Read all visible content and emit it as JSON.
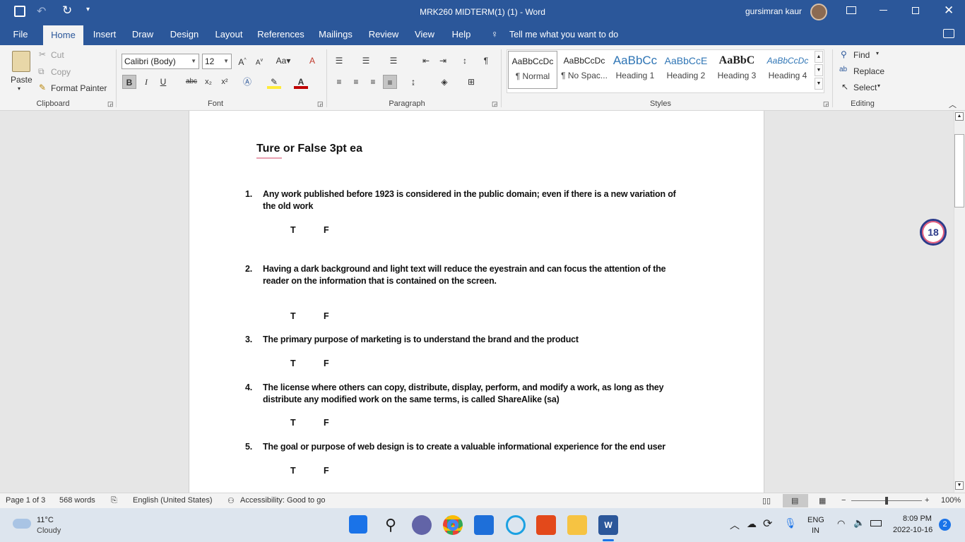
{
  "window": {
    "title": "MRK260 MIDTERM(1) (1)  -  Word",
    "user": "gursimran kaur"
  },
  "menu": {
    "file": "File",
    "tabs": [
      "Home",
      "Insert",
      "Draw",
      "Design",
      "Layout",
      "References",
      "Mailings",
      "Review",
      "View",
      "Help"
    ],
    "tell_me": "Tell me what you want to do"
  },
  "ribbon": {
    "clipboard": {
      "paste": "Paste",
      "cut": "Cut",
      "copy": "Copy",
      "format_painter": "Format Painter",
      "label": "Clipboard"
    },
    "font": {
      "name": "Calibri (Body)",
      "size": "12",
      "label": "Font"
    },
    "paragraph": {
      "label": "Paragraph"
    },
    "styles": {
      "label": "Styles",
      "items": [
        {
          "preview": "AaBbCcDc",
          "name": "¶ Normal"
        },
        {
          "preview": "AaBbCcDc",
          "name": "¶ No Spac..."
        },
        {
          "preview": "AaBbCc",
          "name": "Heading 1"
        },
        {
          "preview": "AaBbCcE",
          "name": "Heading 2"
        },
        {
          "preview": "AaBbC",
          "name": "Heading 3"
        },
        {
          "preview": "AaBbCcDc",
          "name": "Heading 4"
        }
      ]
    },
    "editing": {
      "find": "Find",
      "replace": "Replace",
      "select": "Select",
      "label": "Editing"
    }
  },
  "document": {
    "title": "Ture or False 3pt ea",
    "true_label": "T",
    "false_label": "F",
    "questions": [
      {
        "num": "1.",
        "text": "Any work published before 1923 is considered in the public domain; even if there is a new variation of the old work"
      },
      {
        "num": "2.",
        "text": "Having a dark background and light text will reduce the eyestrain and can focus the attention of the reader on the information that is contained on the screen."
      },
      {
        "num": "3.",
        "text": "The primary purpose of marketing is to understand the brand and the product"
      },
      {
        "num": "4.",
        "text": "The license where others can copy, distribute, display, perform, and modify a work, as long as they distribute any modified work on the same terms, is called ShareAlike (sa)"
      },
      {
        "num": "5.",
        "text": " The goal or purpose of web design is to create a valuable informational experience for the end user"
      }
    ]
  },
  "floating_badge": "18",
  "status": {
    "page": "Page 1 of 3",
    "words": "568 words",
    "language": "English (United States)",
    "accessibility": "Accessibility: Good to go",
    "zoom": "100%"
  },
  "taskbar": {
    "weather_temp": "11°C",
    "weather_desc": "Cloudy",
    "lang_top": "ENG",
    "lang_bottom": "IN",
    "time": "8:09 PM",
    "date": "2022-10-16",
    "notifications": "2"
  }
}
